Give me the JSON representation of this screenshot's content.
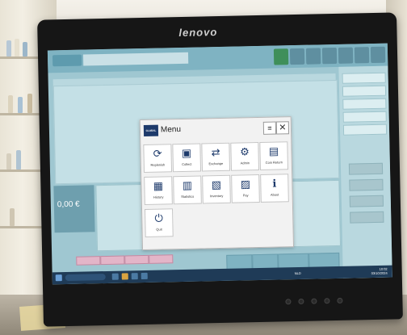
{
  "monitor": {
    "brand": "lenovo"
  },
  "menu": {
    "title": "Menu",
    "logo_text": "GLOBAL",
    "list_icon": "≡",
    "close_icon": "✕",
    "items": [
      {
        "label": "Replenish",
        "icon": "refresh-icon",
        "glyph": "⟳"
      },
      {
        "label": "Collect",
        "icon": "collect-icon",
        "glyph": "▣"
      },
      {
        "label": "Exchange",
        "icon": "exchange-icon",
        "glyph": "⇄"
      },
      {
        "label": "Admin",
        "icon": "gear-icon",
        "glyph": "⚙"
      },
      {
        "label": "Coin Return",
        "icon": "coins-icon",
        "glyph": "▤"
      },
      {
        "label": "History",
        "icon": "history-icon",
        "glyph": "▦"
      },
      {
        "label": "Statistics",
        "icon": "statistics-icon",
        "glyph": "▥"
      },
      {
        "label": "Inventory",
        "icon": "inventory-icon",
        "glyph": "▧"
      },
      {
        "label": "Pay",
        "icon": "pay-icon",
        "glyph": "▨"
      },
      {
        "label": "About",
        "icon": "info-icon",
        "glyph": "ℹ"
      },
      {
        "label": "Quit",
        "icon": "power-icon",
        "glyph": "⏻"
      }
    ]
  },
  "till": {
    "amount": "0,00 €"
  },
  "taskbar": {
    "time": "10:02",
    "date": "03/10/2024",
    "lang": "NLD"
  },
  "colors": {
    "screen_bg": "#9fc7d1",
    "menu_logo": "#1d3a6b",
    "tab_pink": "#e3b5c8"
  }
}
